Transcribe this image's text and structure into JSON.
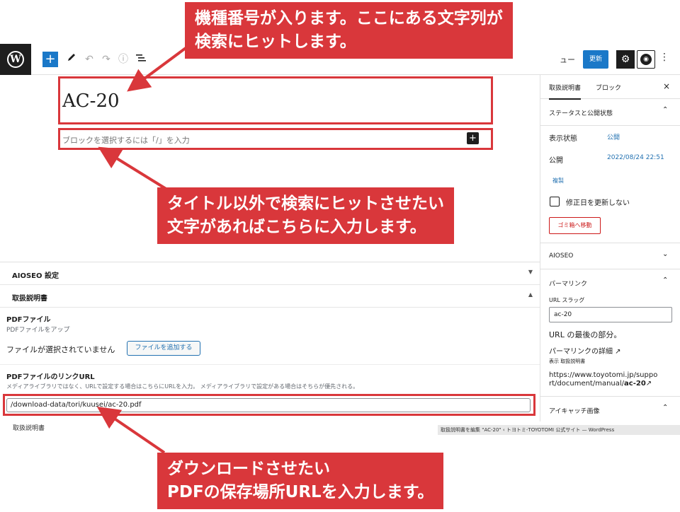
{
  "toolbar": {
    "logo_glyph": "W",
    "add_label": "+",
    "preview_label": "ュー",
    "update_label": "更新",
    "settings_glyph": "⚙",
    "aioseo_glyph": "◉",
    "more_glyph": "⋮"
  },
  "editor": {
    "title": "AC-20",
    "block_hint": "ブロックを選択するには「/」を入力",
    "inserter": "+"
  },
  "meta_boxes": {
    "aioseo_title": "AIOSEO 設定",
    "aioseo_arrow": "▼",
    "manual_title": "取扱説明書",
    "manual_arrow": "▲",
    "pdf_label": "PDFファイル",
    "pdf_desc": "PDFファイルをアップ",
    "no_file": "ファイルが選択されていません",
    "add_file_button": "ファイルを追加する",
    "url_label": "PDFファイルのリンクURL",
    "url_desc": "メディアライブラリではなく、URLで設定する場合はこちらにURLを入力。 メディアライブラリで設定がある場合はそちらが優先される。",
    "url_value": "/download-data/tori/kuusei/ac-20.pdf",
    "footer_breadcrumb": "取扱説明書"
  },
  "sidebar": {
    "tab_document": "取扱説明書",
    "tab_block": "ブロック",
    "close": "×",
    "status_section": "ステータスと公開状態",
    "visibility_label": "表示状態",
    "visibility_value": "公開",
    "publish_label": "公開",
    "publish_value": "2022/08/24 22:51",
    "duplicate": "複製",
    "no_update_date": "修正日を更新しない",
    "trash_button": "ゴミ箱へ移動",
    "aioseo_section": "AIOSEO",
    "permalink_section": "パーマリンク",
    "url_slug_label": "URL スラッグ",
    "url_slug_value": "ac-20",
    "url_last_part": "URL の最後の部分。",
    "permalink_detail": "パーマリンクの詳細",
    "view_label": "表示 取扱説明書",
    "permalink_line1": "https://www.toyotomi.jp/suppo",
    "permalink_line2_a": "rt/document/manual/",
    "permalink_line2_b": "ac-20",
    "featured_section": "アイキャッチ画像",
    "chevron_up": "⌃",
    "chevron_down": "⌄"
  },
  "status_bar": "取扱説明書を編集 \"AC-20\" ‹ トヨトミ-TOYOTOMI 公式サイト — WordPress",
  "annotations": {
    "top_line1": "機種番号が入ります。ここにある文字列が",
    "top_line2": "検索にヒットします。",
    "mid_line1": "タイトル以外で検索にヒットさせたい",
    "mid_line2": "文字があればこちらに入力します。",
    "bottom_line1": "ダウンロードさせたい",
    "bottom_line2": "PDFの保存場所URLを入力します。"
  },
  "colors": {
    "accent": "#1a78c8",
    "annotation_red": "#d9373b",
    "link": "#2271b1",
    "trash": "#cc1818"
  }
}
